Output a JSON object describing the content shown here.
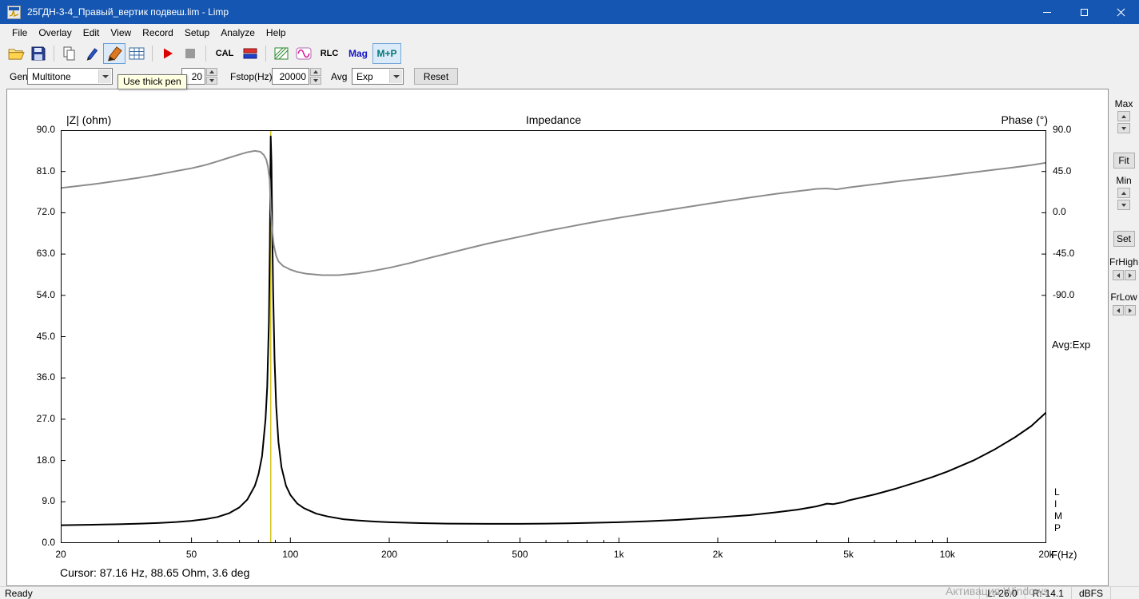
{
  "window": {
    "title": "25ГДН-3-4_Правый_вертик подвеш.lim - Limp",
    "control_icons": [
      "minimize-icon",
      "maximize-icon",
      "close-icon"
    ]
  },
  "menu": {
    "items": [
      "File",
      "Overlay",
      "Edit",
      "View",
      "Record",
      "Setup",
      "Analyze",
      "Help"
    ]
  },
  "toolbar": {
    "icons": [
      "open-folder-icon",
      "save-icon",
      "copy-icon",
      "thin-pen-icon",
      "thick-pen-icon",
      "table-icon",
      "play-icon",
      "stop-icon",
      "lr-calibration-icon",
      "hatch-icon",
      "sine-wave-icon"
    ],
    "cal_label": "CAL",
    "rlc_label": "RLC",
    "mag_label": "Mag",
    "mp_label": "M+P",
    "tooltip": "Use thick pen"
  },
  "controls_bar": {
    "gen_label": "Gen",
    "gen_value": "Multitone",
    "gain_value": "20",
    "fstop_label": "Fstop(Hz)",
    "fstop_value": "20000",
    "avg_label": "Avg",
    "avg_value": "Exp",
    "reset_label": "Reset"
  },
  "side_panel": {
    "max_label": "Max",
    "fit_label": "Fit",
    "min_label": "Min",
    "set_label": "Set",
    "frhigh_label": "FrHigh",
    "frlow_label": "FrLow"
  },
  "status_bar": {
    "ready": "Ready",
    "left_level": "L:-26.0",
    "right_level": "R:-14.1",
    "unit": "dBFS"
  },
  "watermark": "Активация Windows",
  "chart_data": {
    "type": "line",
    "title": "Impedance",
    "left_axis_label": "|Z| (ohm)",
    "right_axis_label": "Phase (°)",
    "x_axis_label": "F(Hz)",
    "avg_note": "Avg:Exp",
    "logo": "LIMP",
    "fmin": 20,
    "fmax": 20000,
    "zmin": 0,
    "zmax": 90,
    "x_scale": "log",
    "grid": false,
    "z_ticks": [
      {
        "value": 0,
        "label": "0.0"
      },
      {
        "value": 9,
        "label": "9.0"
      },
      {
        "value": 18,
        "label": "18.0"
      },
      {
        "value": 27,
        "label": "27.0"
      },
      {
        "value": 36,
        "label": "36.0"
      },
      {
        "value": 45,
        "label": "45.0"
      },
      {
        "value": 54,
        "label": "54.0"
      },
      {
        "value": 63,
        "label": "63.0"
      },
      {
        "value": 72,
        "label": "72.0"
      },
      {
        "value": 81,
        "label": "81.0"
      },
      {
        "value": 90,
        "label": "90.0"
      }
    ],
    "phase_ticks": [
      {
        "value": 90,
        "label": "90.0"
      },
      {
        "value": 45,
        "label": "45.0"
      },
      {
        "value": 0,
        "label": "0.0"
      },
      {
        "value": -45,
        "label": "-45.0"
      },
      {
        "value": -90,
        "label": "-90.0"
      }
    ],
    "phase_map": {
      "offset": 72,
      "scale": 0.2
    },
    "x_ticks": [
      {
        "value": 20,
        "label": "20"
      },
      {
        "value": 50,
        "label": "50"
      },
      {
        "value": 100,
        "label": "100"
      },
      {
        "value": 200,
        "label": "200"
      },
      {
        "value": 500,
        "label": "500"
      },
      {
        "value": 1000,
        "label": "1k"
      },
      {
        "value": 2000,
        "label": "2k"
      },
      {
        "value": 5000,
        "label": "5k"
      },
      {
        "value": 10000,
        "label": "10k"
      },
      {
        "value": 20000,
        "label": "20k"
      }
    ],
    "x_minor_ticks": [
      30,
      40,
      60,
      70,
      80,
      90,
      300,
      400,
      600,
      700,
      800,
      900,
      3000,
      4000,
      6000,
      7000,
      8000,
      9000
    ],
    "cursor": {
      "freq": 87.16,
      "impedance": 88.65,
      "phase": 3.6,
      "text": "Cursor: 87.16 Hz, 88.65 Ohm, 3.6 deg",
      "color": "#cfc21c"
    },
    "series": [
      {
        "name": "impedance",
        "axis": "z",
        "color": "#000000",
        "width": 2,
        "points": [
          [
            20,
            3.9
          ],
          [
            25,
            4.0
          ],
          [
            30,
            4.1
          ],
          [
            35,
            4.25
          ],
          [
            40,
            4.4
          ],
          [
            45,
            4.6
          ],
          [
            50,
            4.85
          ],
          [
            55,
            5.2
          ],
          [
            60,
            5.7
          ],
          [
            65,
            6.5
          ],
          [
            70,
            7.8
          ],
          [
            74,
            9.5
          ],
          [
            78,
            12.5
          ],
          [
            80,
            15
          ],
          [
            82,
            19
          ],
          [
            84,
            27
          ],
          [
            85,
            34
          ],
          [
            86,
            48
          ],
          [
            86.6,
            65
          ],
          [
            87.16,
            88.65
          ],
          [
            87.6,
            83
          ],
          [
            88,
            70
          ],
          [
            88.6,
            55
          ],
          [
            89.5,
            40
          ],
          [
            90.5,
            30
          ],
          [
            92,
            22
          ],
          [
            94,
            16.5
          ],
          [
            97,
            12.5
          ],
          [
            100,
            10.5
          ],
          [
            105,
            8.6
          ],
          [
            110,
            7.6
          ],
          [
            120,
            6.4
          ],
          [
            130,
            5.8
          ],
          [
            145,
            5.2
          ],
          [
            160,
            4.95
          ],
          [
            180,
            4.7
          ],
          [
            200,
            4.55
          ],
          [
            250,
            4.35
          ],
          [
            300,
            4.25
          ],
          [
            400,
            4.2
          ],
          [
            500,
            4.2
          ],
          [
            600,
            4.25
          ],
          [
            700,
            4.3
          ],
          [
            800,
            4.4
          ],
          [
            1000,
            4.55
          ],
          [
            1200,
            4.75
          ],
          [
            1500,
            5.05
          ],
          [
            2000,
            5.6
          ],
          [
            2500,
            6.1
          ],
          [
            3000,
            6.7
          ],
          [
            3500,
            7.3
          ],
          [
            4000,
            8.0
          ],
          [
            4300,
            8.6
          ],
          [
            4500,
            8.5
          ],
          [
            4800,
            8.9
          ],
          [
            5000,
            9.3
          ],
          [
            6000,
            10.6
          ],
          [
            7000,
            11.9
          ],
          [
            8000,
            13.2
          ],
          [
            9000,
            14.4
          ],
          [
            10000,
            15.6
          ],
          [
            12000,
            18.0
          ],
          [
            14000,
            20.5
          ],
          [
            16000,
            23.0
          ],
          [
            18000,
            25.5
          ],
          [
            20000,
            28.5
          ]
        ]
      },
      {
        "name": "phase",
        "axis": "phase",
        "color": "#8c8c8c",
        "width": 2,
        "points": [
          [
            20,
            27
          ],
          [
            25,
            31
          ],
          [
            30,
            35
          ],
          [
            35,
            38.5
          ],
          [
            40,
            42
          ],
          [
            45,
            45.5
          ],
          [
            50,
            48.5
          ],
          [
            55,
            52
          ],
          [
            60,
            56
          ],
          [
            65,
            60
          ],
          [
            70,
            63.5
          ],
          [
            74,
            66
          ],
          [
            78,
            67.5
          ],
          [
            81,
            66.5
          ],
          [
            83,
            63
          ],
          [
            84.5,
            58
          ],
          [
            85.5,
            50
          ],
          [
            86.5,
            36
          ],
          [
            87.16,
            3.6
          ],
          [
            88,
            -18
          ],
          [
            89,
            -35
          ],
          [
            90.5,
            -47
          ],
          [
            92,
            -53
          ],
          [
            95,
            -58
          ],
          [
            100,
            -62
          ],
          [
            105,
            -64.5
          ],
          [
            112,
            -66.5
          ],
          [
            125,
            -68
          ],
          [
            140,
            -68
          ],
          [
            160,
            -66
          ],
          [
            180,
            -63
          ],
          [
            200,
            -60
          ],
          [
            230,
            -55
          ],
          [
            260,
            -50
          ],
          [
            300,
            -44.5
          ],
          [
            350,
            -38.5
          ],
          [
            400,
            -33.5
          ],
          [
            500,
            -26
          ],
          [
            600,
            -20
          ],
          [
            700,
            -15.5
          ],
          [
            800,
            -11.5
          ],
          [
            1000,
            -5.5
          ],
          [
            1200,
            -1
          ],
          [
            1500,
            4.5
          ],
          [
            2000,
            11.5
          ],
          [
            2500,
            16.5
          ],
          [
            3000,
            20.5
          ],
          [
            3500,
            23.5
          ],
          [
            4000,
            26
          ],
          [
            4300,
            26.5
          ],
          [
            4600,
            25.5
          ],
          [
            5000,
            27.5
          ],
          [
            6000,
            31
          ],
          [
            7000,
            34
          ],
          [
            8000,
            36.5
          ],
          [
            9000,
            38.5
          ],
          [
            10000,
            40.5
          ],
          [
            12000,
            44
          ],
          [
            14000,
            47
          ],
          [
            16000,
            49.5
          ],
          [
            18000,
            52
          ],
          [
            20000,
            54.5
          ]
        ]
      }
    ]
  }
}
